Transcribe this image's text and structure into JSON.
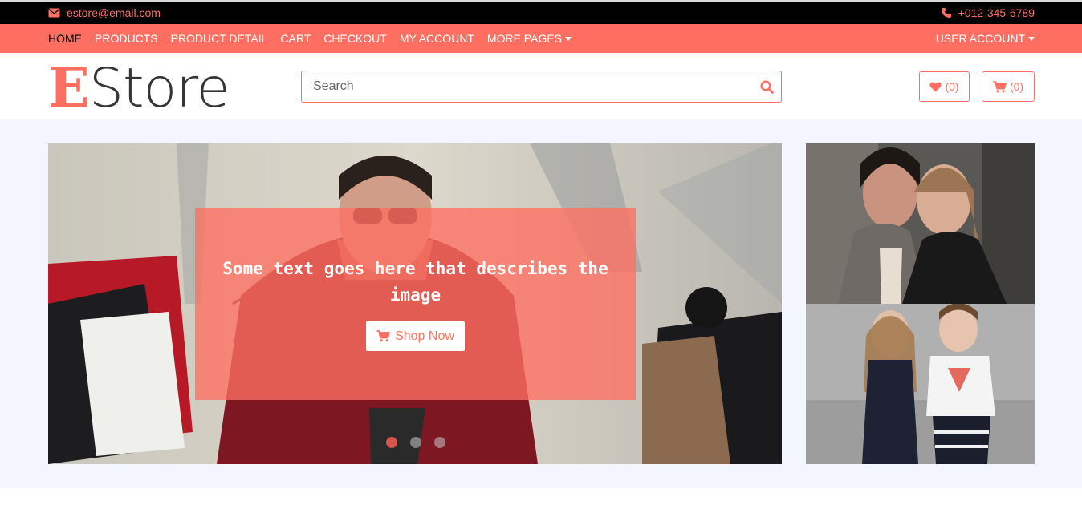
{
  "topbar": {
    "email": "estore@email.com",
    "phone": "+012-345-6789",
    "email_icon": "envelope-icon",
    "phone_icon": "phone-icon"
  },
  "nav": {
    "items": [
      {
        "label": "HOME",
        "active": true
      },
      {
        "label": "PRODUCTS"
      },
      {
        "label": "PRODUCT DETAIL"
      },
      {
        "label": "CART"
      },
      {
        "label": "CHECKOUT"
      },
      {
        "label": "MY ACCOUNT"
      },
      {
        "label": "MORE PAGES",
        "dropdown": true
      }
    ],
    "user_account": "USER ACCOUNT"
  },
  "header": {
    "logo_first": "E",
    "logo_rest": "Store",
    "search_placeholder": "Search",
    "wishlist_count": "(0)",
    "cart_count": "(0)"
  },
  "slider": {
    "caption": "Some text goes here that describes the image",
    "button": "Shop Now",
    "slide_count": 3,
    "active_slide": 1
  },
  "colors": {
    "accent": "#ff6f61",
    "topbar": "#000000",
    "section_bg": "#f3f6ff"
  }
}
